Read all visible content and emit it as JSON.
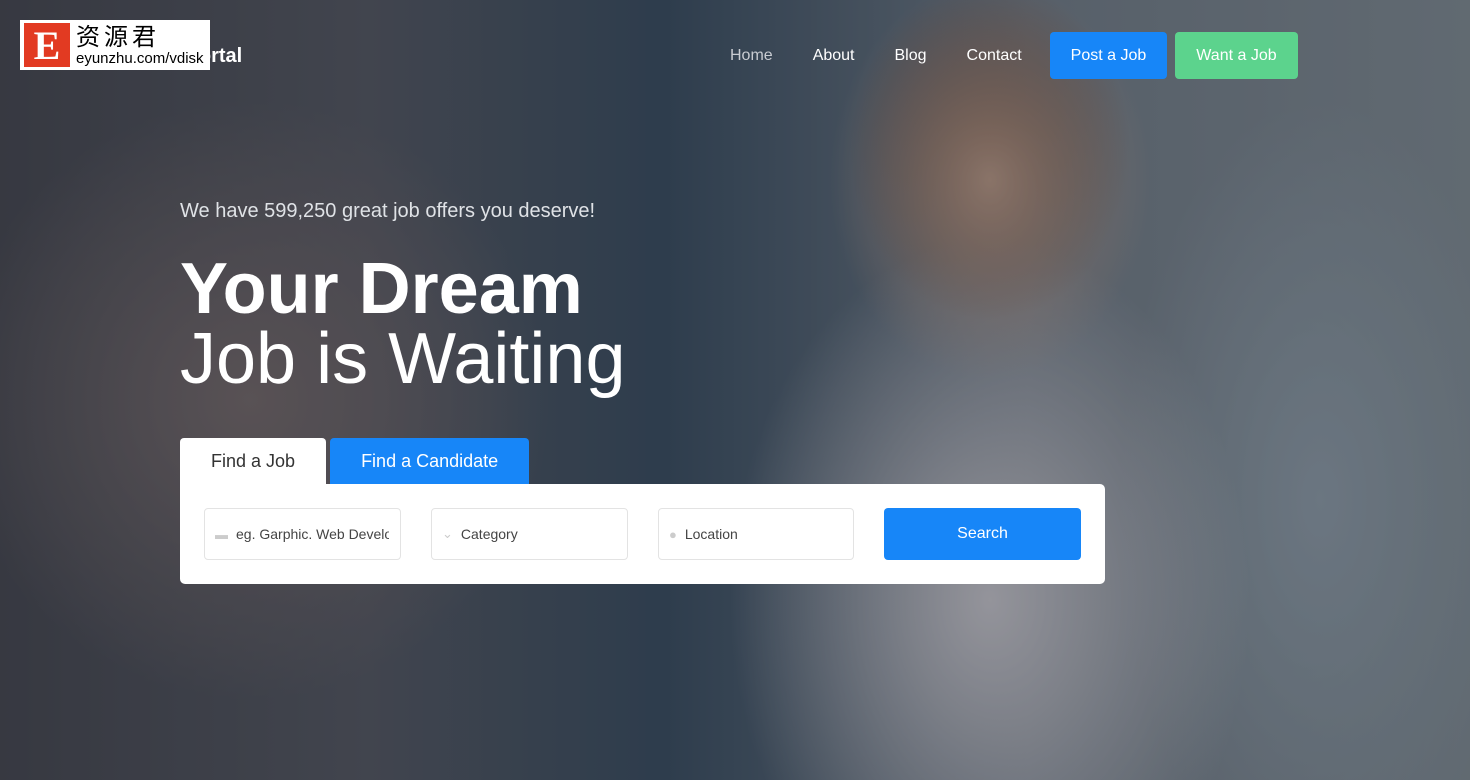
{
  "watermark": {
    "letter": "E",
    "name": "资源君",
    "url": "eyunzhu.com/vdisk"
  },
  "brand": "JobPortal",
  "nav": {
    "items": [
      "Home",
      "About",
      "Blog",
      "Contact"
    ],
    "post_job": "Post a Job",
    "want_job": "Want a Job"
  },
  "hero": {
    "subtitle": "We have 599,250 great job offers you deserve!",
    "title_line1": "Your Dream",
    "title_line2": "Job is Waiting"
  },
  "tabs": [
    "Find a Job",
    "Find a Candidate"
  ],
  "search": {
    "keyword_placeholder": "eg. Garphic. Web Developer",
    "category": "Category",
    "location": "Location",
    "button": "Search"
  },
  "colors": {
    "primary": "#1786f8",
    "success": "#5cd38d"
  }
}
